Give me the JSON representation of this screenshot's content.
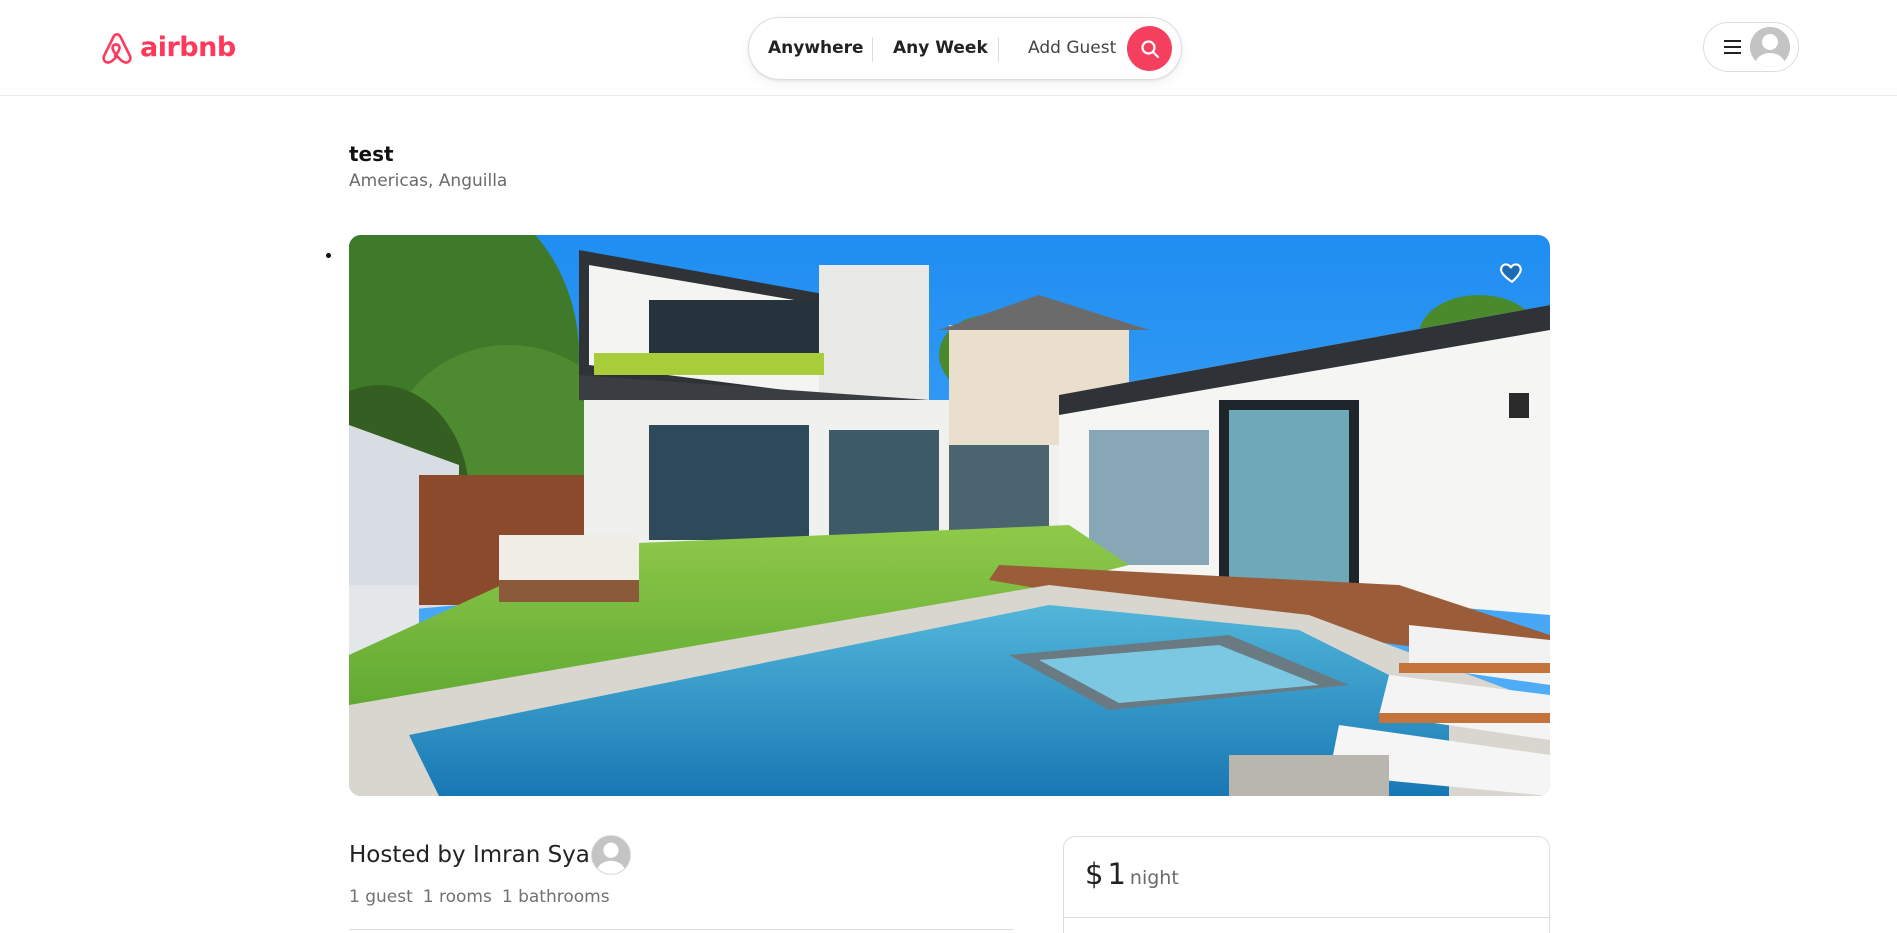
{
  "header": {
    "logo_text": "airbnb",
    "brand_color": "#FF385C",
    "search": {
      "anywhere_label": "Anywhere",
      "week_label": "Any Week",
      "guest_label": "Add Guest",
      "button_icon": "search-icon",
      "button_color": "#F43F5E"
    },
    "user_menu": {
      "menu_icon": "hamburger-menu-icon",
      "avatar_icon": "default-avatar-icon"
    }
  },
  "listing": {
    "title": "test",
    "location": "Americas, Anguilla",
    "favorite_icon": "heart-icon"
  },
  "host": {
    "hosted_by": "Hosted by Imran Syam",
    "stats": {
      "guests": "1 guest",
      "rooms": "1 rooms",
      "bathrooms": "1 bathrooms"
    }
  },
  "booking": {
    "currency": "$",
    "price": "1",
    "unit": "night"
  }
}
